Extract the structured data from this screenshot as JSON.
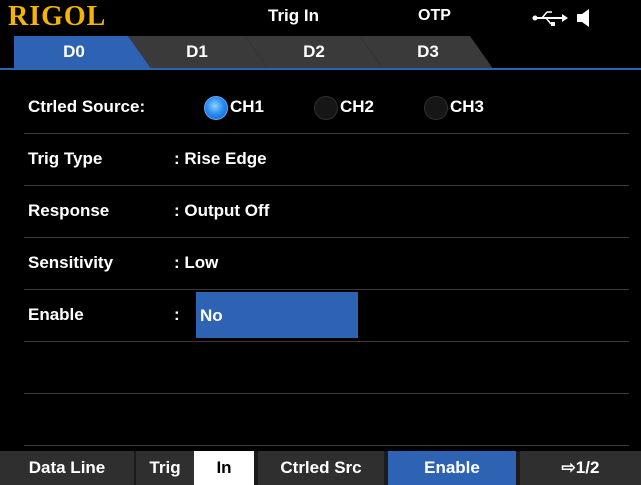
{
  "header": {
    "brand": "RIGOL",
    "mode": "Trig In",
    "status": "OTP",
    "icons": [
      "usb-icon",
      "speaker-icon"
    ]
  },
  "tabs": [
    {
      "label": "D0",
      "active": true
    },
    {
      "label": "D1",
      "active": false
    },
    {
      "label": "D2",
      "active": false
    },
    {
      "label": "D3",
      "active": false
    }
  ],
  "settings": {
    "ctrled_source": {
      "label": "Ctrled Source:",
      "options": [
        "CH1",
        "CH2",
        "CH3"
      ],
      "selected": "CH1"
    },
    "trig_type": {
      "label": "Trig Type",
      "value": ": Rise Edge"
    },
    "response": {
      "label": "Response",
      "value": ": Output Off"
    },
    "sensitivity": {
      "label": "Sensitivity",
      "value": ": Low"
    },
    "enable": {
      "label": "Enable",
      "value": ": No",
      "value_prefix": ":",
      "value_text": "No"
    }
  },
  "softkeys": [
    {
      "label": "Data Line"
    },
    {
      "label": "Trig"
    },
    {
      "label": "In"
    },
    {
      "label": "Ctrled Src"
    },
    {
      "label": "Enable"
    },
    {
      "label": "⇨1/2"
    }
  ],
  "colors": {
    "brand": "#f4b400",
    "active_tab": "#2e63b3",
    "inactive_tab": "#3a3a3a",
    "highlight": "#2e63b3"
  }
}
